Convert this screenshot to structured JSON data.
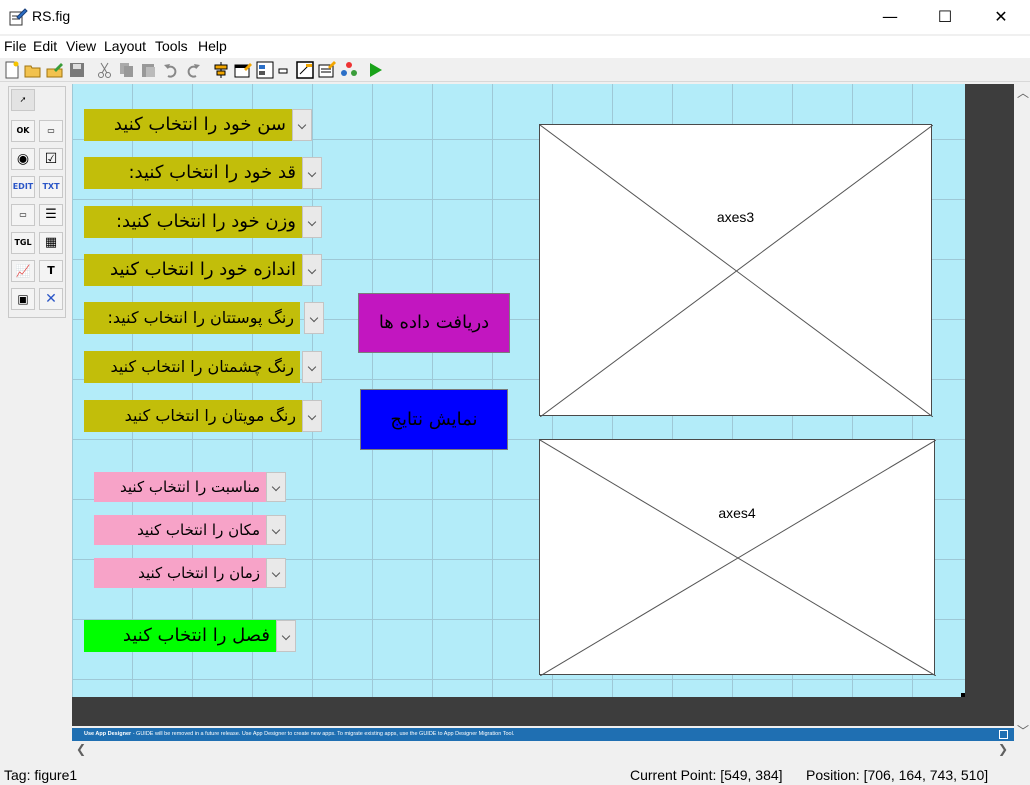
{
  "window": {
    "title": "RS.fig",
    "minimize": "—",
    "maximize": "☐",
    "close": "✕"
  },
  "menu": [
    "File",
    "Edit",
    "View",
    "Layout",
    "Tools",
    "Help"
  ],
  "palette": [
    {
      "name": "select-tool-icon",
      "glyph": "➚"
    },
    {
      "name": "pushbutton-tool-icon",
      "glyph": "OK"
    },
    {
      "name": "slider-tool-icon",
      "glyph": "▭"
    },
    {
      "name": "radiobutton-tool-icon",
      "glyph": "◉"
    },
    {
      "name": "checkbox-tool-icon",
      "glyph": "☑"
    },
    {
      "name": "edit-text-tool-icon",
      "glyph": "EDIT"
    },
    {
      "name": "static-text-tool-icon",
      "glyph": "TXT"
    },
    {
      "name": "popupmenu-tool-icon",
      "glyph": "▭"
    },
    {
      "name": "listbox-tool-icon",
      "glyph": "☰"
    },
    {
      "name": "toggle-tool-icon",
      "glyph": "TGL"
    },
    {
      "name": "table-tool-icon",
      "glyph": "▦"
    },
    {
      "name": "axes-tool-icon",
      "glyph": "📈"
    },
    {
      "name": "panel-tool-icon",
      "glyph": "T"
    },
    {
      "name": "buttongroup-tool-icon",
      "glyph": "▣"
    },
    {
      "name": "activex-tool-icon",
      "glyph": "✕"
    }
  ],
  "popups": [
    {
      "label": "سن خود را انتخاب کنید",
      "color": "#c2be0a",
      "size": 18
    },
    {
      "label": "قد خود را انتخاب کنید:",
      "color": "#c2be0a",
      "size": 18
    },
    {
      "label": "وزن خود را انتخاب کنید:",
      "color": "#c2be0a",
      "size": 18
    },
    {
      "label": "اندازه خود را انتخاب کنید",
      "color": "#c2be0a",
      "size": 18
    },
    {
      "label": "رنگ پوستتان را انتخاب کنید:",
      "color": "#c2be0a",
      "size": 16
    },
    {
      "label": "رنگ چشمتان را انتخاب کنید",
      "color": "#c2be0a",
      "size": 16
    },
    {
      "label": "رنگ مویتان را انتخاب کنید",
      "color": "#c2be0a",
      "size": 16
    },
    {
      "label": "مناسبت را انتخاب کنید",
      "color": "#f7a3c8",
      "size": 15
    },
    {
      "label": "مکان را انتخاب کنید",
      "color": "#f7a3c8",
      "size": 15
    },
    {
      "label": "زمان را انتخاب کنید",
      "color": "#f7a3c8",
      "size": 15
    },
    {
      "label": "فصل را انتخاب کنید",
      "color": "#00ff00",
      "size": 18
    }
  ],
  "buttons": {
    "receive": {
      "label": "دریافت داده ها",
      "color": "#c216c0"
    },
    "show": {
      "label": "نمایش نتایج",
      "color": "#0000ff"
    }
  },
  "axes": [
    {
      "label": "axes3"
    },
    {
      "label": "axes4"
    }
  ],
  "notice": {
    "bold": "Use App Designer",
    "text": " - GUIDE will be removed in a future release. Use App Designer to create new apps. To migrate existing apps, use the GUIDE to App Designer Migration Tool."
  },
  "status": {
    "tag": "Tag: figure1",
    "current_point": "Current Point:  [549, 384]",
    "position": "Position: [706, 164, 743, 510]"
  }
}
